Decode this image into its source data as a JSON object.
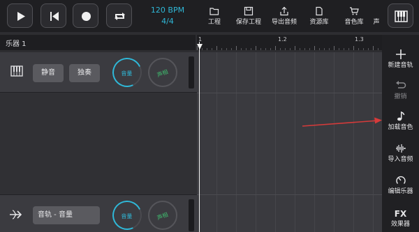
{
  "transport": {
    "play_icon": "play-icon",
    "skip_back_icon": "skip-back-icon",
    "record_icon": "record-icon",
    "loop_icon": "loop-icon",
    "bpm": "120 BPM",
    "time_signature": "4/4"
  },
  "menu": {
    "project": "工程",
    "save_project": "保存工程",
    "export_audio": "导出音频",
    "resource_library": "资源库",
    "sound_library": "音色库",
    "cut_off": "声"
  },
  "instrument_header": {
    "title": "乐器 1"
  },
  "ruler": {
    "marks": [
      "1",
      "1.2",
      "1.3"
    ]
  },
  "track1": {
    "mute": "静音",
    "solo": "独奏",
    "volume_knob": "音量",
    "pan_knob": "声相"
  },
  "track2": {
    "name": "音轨 - 音量",
    "volume_knob": "音量",
    "pan_knob": "声相"
  },
  "sidebar": {
    "new_track": "新建音轨",
    "undo": "撤销",
    "load_sound": "加载音色",
    "import_audio": "导入音频",
    "edit_instrument": "编辑乐器",
    "fx_symbol": "FX",
    "effects": "效果器"
  },
  "colors": {
    "accent": "#2fb8d8",
    "pan_green": "#3fbf6f",
    "annotation_arrow": "#d63a3a"
  }
}
